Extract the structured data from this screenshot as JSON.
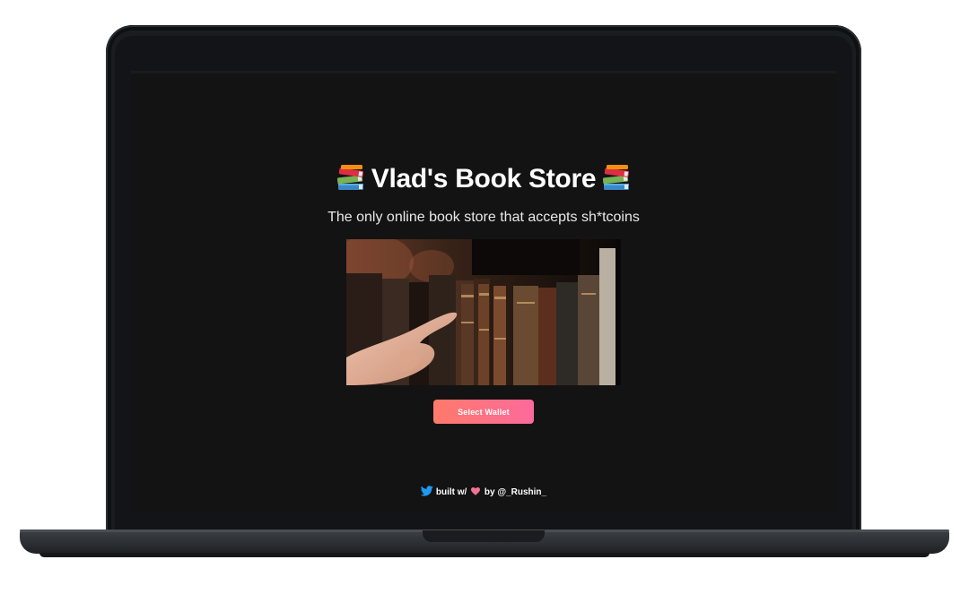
{
  "page": {
    "title": "Vlad's Book Store",
    "title_emoji": "books-emoji-icon",
    "tagline": "The only online book store that accepts sh*tcoins",
    "hero_image": "books-on-shelf-image",
    "wallet_button_label": "Select Wallet",
    "footer": {
      "icon": "twitter-icon",
      "prefix": "built w/",
      "heart_icon": "heart-icon",
      "middle": "by",
      "handle": "@_Rushin_"
    }
  },
  "colors": {
    "background": "#131313",
    "button_gradient_start": "#ff7a6b",
    "button_gradient_end": "#fc6a9c",
    "twitter_blue": "#1d9bf0",
    "heart_pink": "#f4728f"
  }
}
